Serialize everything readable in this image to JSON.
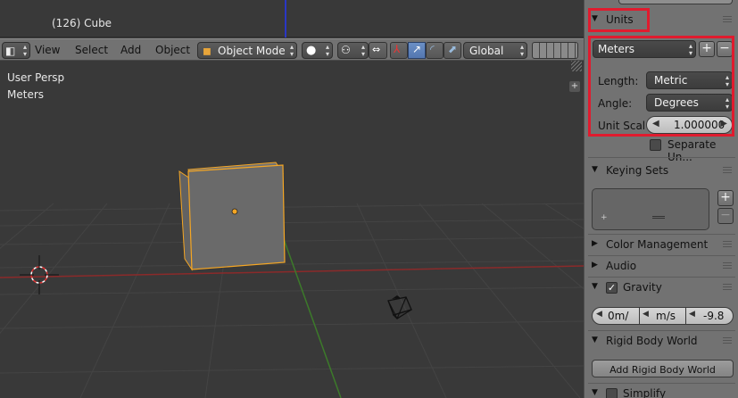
{
  "viewport": {
    "selection_info": "(126) Cube",
    "view_name": "User Persp",
    "units_label": "Meters",
    "menu": [
      "View",
      "Select",
      "Add",
      "Object"
    ],
    "mode": "Object Mode",
    "orientation": "Global"
  },
  "panel": {
    "units": {
      "title": "Units",
      "preset": "Meters",
      "length_label": "Length:",
      "length_value": "Metric",
      "angle_label": "Angle:",
      "angle_value": "Degrees",
      "scale_label": "Unit Scal",
      "scale_value": "1.000000",
      "separate_units": "Separate Un..."
    },
    "keying_sets": {
      "title": "Keying Sets"
    },
    "color_management": {
      "title": "Color Management"
    },
    "audio": {
      "title": "Audio"
    },
    "gravity": {
      "title": "Gravity",
      "x": "0m/",
      "y": "m/s",
      "z": "-9.8"
    },
    "rigid_body_world": {
      "title": "Rigid Body World",
      "add_button": "Add Rigid Body World"
    },
    "simplify": {
      "title": "Simplify"
    }
  },
  "colors": {
    "highlight_box": "#e01b2e",
    "selection_outline": "#f5a623",
    "x_axis": "#8b2a2a",
    "y_axis": "#3c7a2a"
  }
}
